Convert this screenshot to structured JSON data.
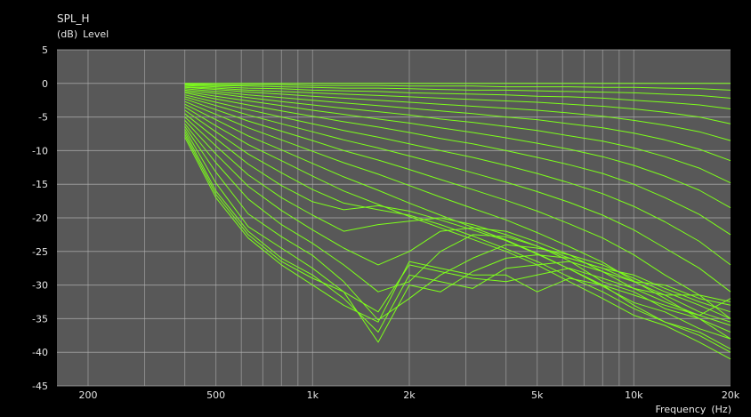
{
  "chart_data": {
    "type": "line",
    "title": "SPL_H",
    "ylabel_unit": "(dB)",
    "ylabel": "Level",
    "xlabel": "Frequency",
    "xlabel_unit": "(Hz)",
    "x_scale": "log",
    "xlim": [
      160,
      20000
    ],
    "ylim": [
      -45,
      5
    ],
    "x_ticks": [
      200,
      500,
      1000,
      2000,
      5000,
      10000,
      20000
    ],
    "x_tick_labels": [
      "200",
      "500",
      "1k",
      "2k",
      "5k",
      "10k",
      "20k"
    ],
    "y_ticks": [
      5,
      0,
      -5,
      -10,
      -15,
      -20,
      -25,
      -30,
      -35,
      -40,
      -45
    ],
    "y_tick_labels": [
      "5",
      "0",
      "-5",
      "-10",
      "-15",
      "-20",
      "-25",
      "-30",
      "-35",
      "-40",
      "-45"
    ],
    "grid": true,
    "background_color": "#585858",
    "grid_color": "#b4b4b4",
    "line_color": "#7dff1a",
    "x": [
      400,
      500,
      630,
      800,
      1000,
      1250,
      1600,
      2000,
      2500,
      3150,
      4000,
      5000,
      6300,
      8000,
      10000,
      12500,
      16000,
      20000
    ],
    "series": [
      {
        "values": [
          0,
          0,
          0,
          0,
          0,
          0,
          0,
          0,
          0,
          0,
          0,
          0,
          0,
          0,
          0,
          0,
          0,
          0
        ]
      },
      {
        "values": [
          -0.1,
          -0.2,
          -0.2,
          -0.2,
          -0.3,
          -0.3,
          -0.3,
          -0.4,
          -0.4,
          -0.4,
          -0.5,
          -0.5,
          -0.5,
          -0.6,
          -0.6,
          -0.7,
          -0.8,
          -1.0
        ]
      },
      {
        "values": [
          -0.2,
          -0.3,
          -0.4,
          -0.5,
          -0.6,
          -0.7,
          -0.7,
          -0.8,
          -0.9,
          -1.0,
          -1.0,
          -1.1,
          -1.2,
          -1.3,
          -1.4,
          -1.6,
          -1.8,
          -2.2
        ]
      },
      {
        "values": [
          -0.3,
          -0.5,
          -0.7,
          -0.8,
          -1.0,
          -1.1,
          -1.2,
          -1.4,
          -1.5,
          -1.6,
          -1.7,
          -1.9,
          -2.0,
          -2.2,
          -2.5,
          -2.8,
          -3.2,
          -3.8
        ]
      },
      {
        "values": [
          -0.5,
          -0.7,
          -1.0,
          -1.2,
          -1.4,
          -1.6,
          -1.8,
          -2.0,
          -2.2,
          -2.4,
          -2.6,
          -2.8,
          -3.1,
          -3.4,
          -3.8,
          -4.3,
          -5.0,
          -6.0
        ]
      },
      {
        "values": [
          -0.6,
          -0.9,
          -1.3,
          -1.6,
          -1.9,
          -2.2,
          -2.5,
          -2.8,
          -3.1,
          -3.4,
          -3.7,
          -4.0,
          -4.4,
          -4.9,
          -5.5,
          -6.2,
          -7.2,
          -8.5
        ]
      },
      {
        "values": [
          -0.8,
          -1.2,
          -1.7,
          -2.1,
          -2.5,
          -2.9,
          -3.3,
          -3.7,
          -4.1,
          -4.5,
          -5.0,
          -5.4,
          -6.0,
          -6.6,
          -7.4,
          -8.4,
          -9.8,
          -11.5
        ]
      },
      {
        "values": [
          -1.0,
          -1.5,
          -2.1,
          -2.7,
          -3.2,
          -3.7,
          -4.2,
          -4.7,
          -5.3,
          -5.8,
          -6.4,
          -7.0,
          -7.8,
          -8.6,
          -9.6,
          -10.9,
          -12.6,
          -14.8
        ]
      },
      {
        "values": [
          -1.2,
          -1.9,
          -2.6,
          -3.3,
          -4.0,
          -4.6,
          -5.3,
          -5.9,
          -6.6,
          -7.3,
          -8.1,
          -8.9,
          -9.8,
          -10.9,
          -12.2,
          -13.8,
          -15.9,
          -18.5
        ]
      },
      {
        "values": [
          -1.4,
          -2.3,
          -3.2,
          -4.1,
          -4.9,
          -5.7,
          -6.5,
          -7.3,
          -8.2,
          -9.0,
          -10.0,
          -11.0,
          -12.1,
          -13.4,
          -15.0,
          -17.0,
          -19.5,
          -22.5
        ]
      },
      {
        "values": [
          -1.7,
          -2.8,
          -3.9,
          -5.0,
          -6.0,
          -7.0,
          -8.0,
          -9.0,
          -10.0,
          -11.0,
          -12.2,
          -13.4,
          -14.8,
          -16.4,
          -18.3,
          -20.6,
          -23.5,
          -27.0
        ]
      },
      {
        "values": [
          -2.0,
          -3.3,
          -4.7,
          -6.0,
          -7.2,
          -8.4,
          -9.6,
          -10.8,
          -12.0,
          -13.3,
          -14.7,
          -16.1,
          -17.7,
          -19.6,
          -21.8,
          -24.5,
          -27.5,
          -31.0
        ]
      },
      {
        "values": [
          -2.3,
          -3.9,
          -5.6,
          -7.1,
          -8.5,
          -10.0,
          -11.4,
          -12.8,
          -14.3,
          -15.8,
          -17.4,
          -19.0,
          -20.9,
          -23.0,
          -25.5,
          -28.5,
          -31.5,
          -35.0
        ]
      },
      {
        "values": [
          -2.7,
          -4.6,
          -6.6,
          -8.4,
          -10.1,
          -11.8,
          -13.5,
          -15.2,
          -16.9,
          -18.6,
          -20.3,
          -22.2,
          -24.3,
          -26.6,
          -29.4,
          -32.0,
          -35.0,
          -38.0
        ]
      },
      {
        "values": [
          -3.1,
          -5.4,
          -7.8,
          -9.9,
          -11.9,
          -13.9,
          -15.9,
          -17.8,
          -19.6,
          -21.4,
          -23.3,
          -25.3,
          -27.6,
          -30.0,
          -33.0,
          -35.5,
          -37.5,
          -40.0
        ]
      },
      {
        "values": [
          -3.5,
          -6.3,
          -9.1,
          -11.5,
          -13.8,
          -16.0,
          -18.0,
          -19.8,
          -21.5,
          -23.2,
          -25.0,
          -27.0,
          -29.5,
          -32.0,
          -34.5,
          -36.0,
          -38.5,
          -41.0
        ]
      },
      {
        "values": [
          -4.0,
          -7.2,
          -10.5,
          -13.3,
          -15.8,
          -17.8,
          -18.8,
          -19.6,
          -21.0,
          -22.7,
          -24.6,
          -26.5,
          -28.8,
          -31.0,
          -33.5,
          -35.5,
          -37.0,
          -39.5
        ]
      },
      {
        "values": [
          -4.5,
          -8.2,
          -12.0,
          -15.2,
          -17.6,
          -18.8,
          -18.2,
          -19.0,
          -20.3,
          -21.8,
          -23.4,
          -25.4,
          -27.6,
          -30.2,
          -32.6,
          -34.0,
          -36.5,
          -38.0
        ]
      },
      {
        "values": [
          -5.0,
          -9.3,
          -13.6,
          -17.0,
          -19.6,
          -22.0,
          -21.0,
          -20.5,
          -20.0,
          -21.0,
          -22.5,
          -24.2,
          -26.4,
          -29.5,
          -31.0,
          -33.5,
          -35.0,
          -37.0
        ]
      },
      {
        "values": [
          -5.5,
          -10.5,
          -15.3,
          -18.9,
          -21.8,
          -24.5,
          -27.0,
          -25.0,
          -22.0,
          -21.5,
          -22.0,
          -23.6,
          -25.5,
          -28.0,
          -30.5,
          -32.5,
          -34.5,
          -36.0
        ]
      },
      {
        "values": [
          -6.0,
          -11.8,
          -17.2,
          -21.0,
          -23.8,
          -27.0,
          -31.0,
          -29.5,
          -25.0,
          -22.5,
          -22.8,
          -24.2,
          -26.0,
          -27.5,
          -29.5,
          -31.5,
          -34.0,
          -35.5
        ]
      },
      {
        "values": [
          -6.4,
          -13.2,
          -19.4,
          -22.8,
          -25.6,
          -29.5,
          -35.2,
          -32.0,
          -28.5,
          -26.0,
          -24.0,
          -24.5,
          -25.5,
          -27.0,
          -29.0,
          -31.0,
          -33.0,
          -35.0
        ]
      },
      {
        "values": [
          -6.8,
          -14.8,
          -21.3,
          -24.5,
          -27.5,
          -31.0,
          -38.5,
          -30.0,
          -31.0,
          -28.0,
          -26.0,
          -25.5,
          -26.0,
          -27.5,
          -28.5,
          -30.5,
          -32.5,
          -34.0
        ]
      },
      {
        "values": [
          -7.2,
          -16.0,
          -22.0,
          -26.0,
          -28.5,
          -32.0,
          -37.0,
          -28.5,
          -29.5,
          -30.5,
          -27.5,
          -27.0,
          -26.5,
          -28.0,
          -29.5,
          -30.0,
          -32.0,
          -33.0
        ]
      },
      {
        "values": [
          -7.6,
          -16.5,
          -22.5,
          -26.5,
          -29.0,
          -31.0,
          -34.0,
          -27.0,
          -28.0,
          -29.0,
          -29.5,
          -28.5,
          -27.5,
          -29.0,
          -30.5,
          -31.5,
          -31.5,
          -32.5
        ]
      },
      {
        "values": [
          -8.0,
          -17.0,
          -23.0,
          -27.0,
          -30.0,
          -33.0,
          -35.5,
          -26.5,
          -27.5,
          -28.5,
          -28.5,
          -31.0,
          -29.0,
          -30.0,
          -31.5,
          -33.0,
          -34.5,
          -32.0
        ]
      }
    ]
  }
}
